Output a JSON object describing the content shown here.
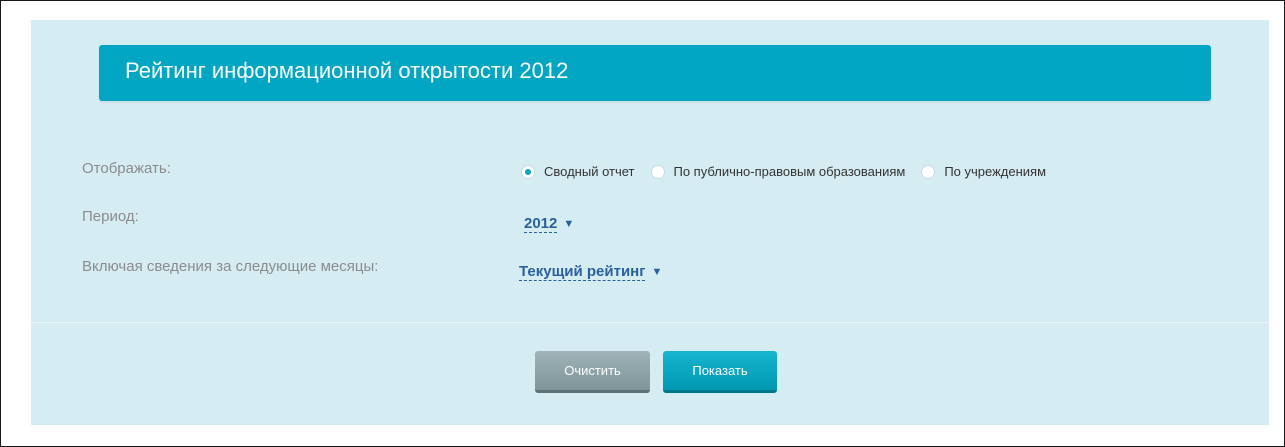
{
  "header": {
    "title": "Рейтинг информационной открытости 2012"
  },
  "display": {
    "label": "Отображать:",
    "options": [
      {
        "label": "Сводный отчет",
        "checked": true
      },
      {
        "label": "По публично-правовым образованиям",
        "checked": false
      },
      {
        "label": "По учреждениям",
        "checked": false
      }
    ]
  },
  "period": {
    "label": "Период:",
    "value": "2012"
  },
  "months": {
    "label": "Включая сведения за следующие месяцы:",
    "value": "Текущий рейтинг"
  },
  "buttons": {
    "clear_label": "Очистить",
    "show_label": "Показать"
  },
  "colors": {
    "accent": "#00a6c2",
    "panel_bg": "#d6ecf3",
    "link": "#2a5fa0",
    "label": "#8c8c8c"
  },
  "icons": {
    "caret": "caret-down-icon",
    "radio": "radio-icon"
  }
}
